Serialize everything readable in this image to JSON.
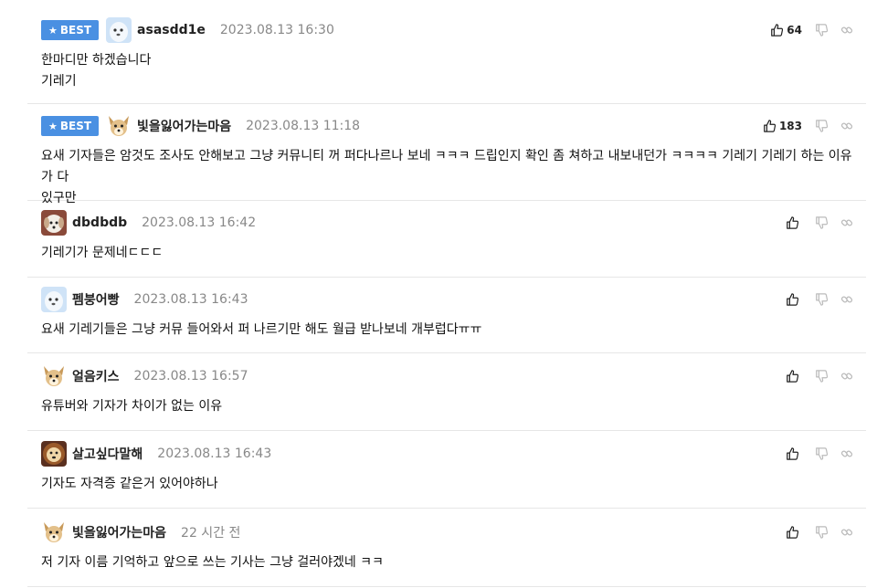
{
  "best_label": "BEST",
  "comments": [
    {
      "best": true,
      "avatar": "ghost-avatar",
      "nick": "asasdd1e",
      "date": "2023.08.13 16:30",
      "lines": [
        "한마디만 하겠습니다",
        "기레기"
      ],
      "likes": "64"
    },
    {
      "best": true,
      "avatar": "dog-avatar",
      "nick": "빛을잃어가는마음",
      "date": "2023.08.13 11:18",
      "lines": [
        "요새 기자들은 암것도 조사도 안해보고 그냥 커뮤니티 꺼 퍼다나르나 보네 ㅋㅋㅋ 드립인지 확인 좀 쳐하고 내보내던가 ㅋㅋㅋㅋ 기레기 기레기 하는 이유가 다",
        "있구만"
      ],
      "likes": "183"
    },
    {
      "best": false,
      "avatar": "puppy-avatar",
      "nick": "dbdbdb",
      "date": "2023.08.13 16:42",
      "lines": [
        "기레기가 문제네ㄷㄷㄷ"
      ],
      "likes": ""
    },
    {
      "best": false,
      "avatar": "ghost-avatar",
      "nick": "펨붕어빵",
      "date": "2023.08.13 16:43",
      "lines": [
        "요새 기레기들은 그냥 커뮤 들어와서 퍼 나르기만 해도 월급 받나보네 개부럽다ㅠㅠ"
      ],
      "likes": ""
    },
    {
      "best": false,
      "avatar": "dog-avatar",
      "nick": "얼음키스",
      "date": "2023.08.13 16:57",
      "lines": [
        "유튜버와 기자가 차이가 없는 이유"
      ],
      "likes": ""
    },
    {
      "best": false,
      "avatar": "lion-avatar",
      "nick": "살고싶다말해",
      "date": "2023.08.13 16:43",
      "lines": [
        "기자도 자격증 같은거 있어야하나"
      ],
      "likes": ""
    },
    {
      "best": false,
      "avatar": "dog-avatar",
      "nick": "빛을잃어가는마음",
      "date": "22 시간 전",
      "lines": [
        "저 기자 이름 기억하고 앞으로 쓰는 기사는 그냥 걸러야겠네 ㅋㅋ"
      ],
      "likes": ""
    }
  ],
  "colors": {
    "best_badge": "#4a90e2",
    "divider": "#e6e6e6",
    "date": "#888888"
  }
}
